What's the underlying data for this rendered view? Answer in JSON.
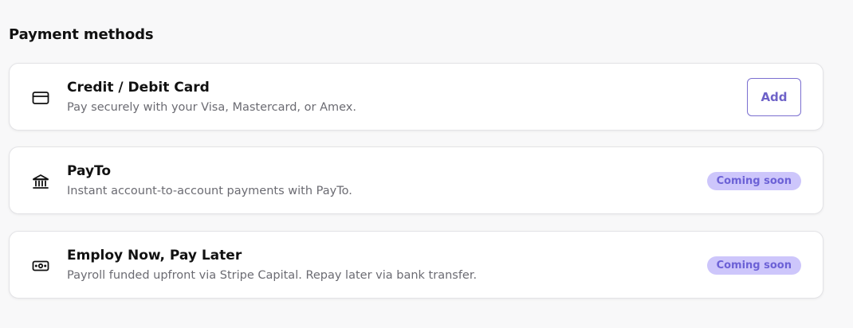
{
  "section": {
    "title": "Payment methods"
  },
  "methods": [
    {
      "title": "Credit / Debit Card",
      "description": "Pay securely with your Visa, Mastercard, or Amex.",
      "icon": "credit-card-icon",
      "action_label": "Add"
    },
    {
      "title": "PayTo",
      "description": "Instant account-to-account payments with PayTo.",
      "icon": "bank-icon",
      "badge": "Coming soon"
    },
    {
      "title": "Employ Now, Pay Later",
      "description": "Payroll funded upfront via Stripe Capital. Repay later via bank transfer.",
      "icon": "cash-icon",
      "badge": "Coming soon"
    }
  ],
  "colors": {
    "accent": "#6e62c8",
    "badge_bg": "#cdc6fb",
    "badge_text": "#6c61d6"
  }
}
